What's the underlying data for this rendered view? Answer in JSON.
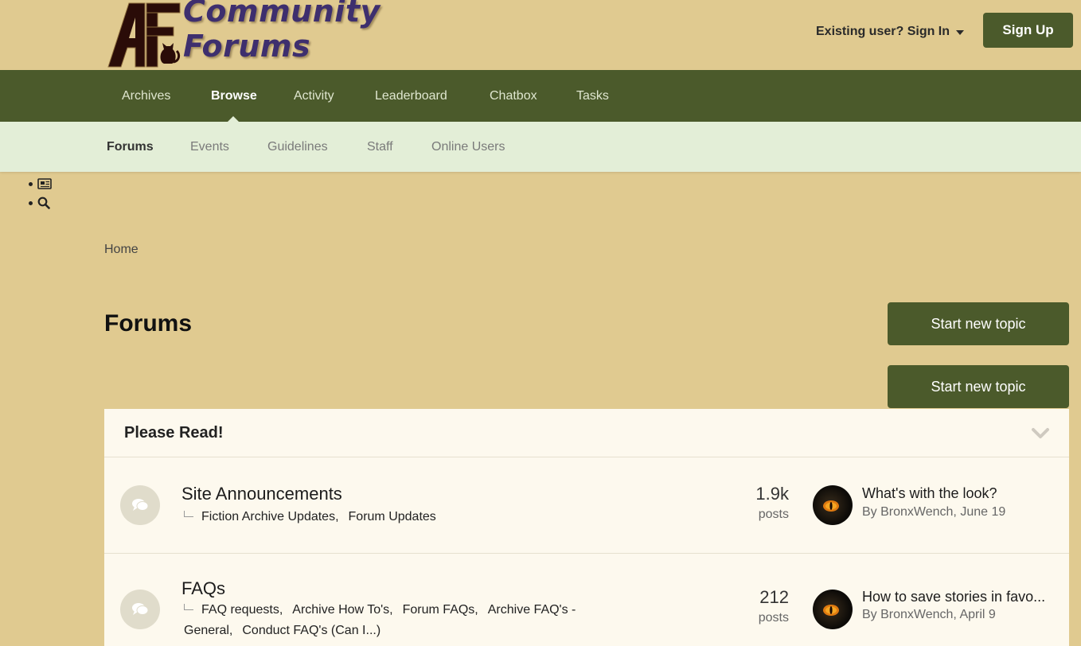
{
  "header": {
    "logo_letters": "AF",
    "logo_title": "Community Forums",
    "signin_label": "Existing user? Sign In",
    "signup_label": "Sign Up"
  },
  "primary_nav": [
    {
      "label": "Archives",
      "active": false
    },
    {
      "label": "Browse",
      "active": true
    },
    {
      "label": "Activity",
      "active": false
    },
    {
      "label": "Leaderboard",
      "active": false
    },
    {
      "label": "Chatbox",
      "active": false
    },
    {
      "label": "Tasks",
      "active": false
    }
  ],
  "secondary_nav": [
    {
      "label": "Forums",
      "active": true
    },
    {
      "label": "Events",
      "active": false
    },
    {
      "label": "Guidelines",
      "active": false
    },
    {
      "label": "Staff",
      "active": false
    },
    {
      "label": "Online Users",
      "active": false
    }
  ],
  "quick_links": [
    {
      "icon": "newspaper-icon"
    },
    {
      "icon": "search-icon"
    }
  ],
  "breadcrumb": {
    "home": "Home"
  },
  "page": {
    "title": "Forums",
    "start_topic_label": "Start new topic"
  },
  "category": {
    "title": "Please Read!",
    "forums": [
      {
        "title": "Site Announcements",
        "subforums": [
          "Fiction Archive Updates,",
          "Forum Updates"
        ],
        "posts": "1.9k",
        "posts_label": "posts",
        "last_post_title": "What's with the look?",
        "last_post_by": "By BronxWench,",
        "last_post_date": "June 19"
      },
      {
        "title": "FAQs",
        "subforums": [
          "FAQ requests,",
          "Archive How To's,",
          "Forum FAQs,",
          "Archive FAQ's - General,",
          "Conduct FAQ's (Can I...)"
        ],
        "posts": "212",
        "posts_label": "posts",
        "last_post_title": "How to save stories in favo...",
        "last_post_by": "By BronxWench,",
        "last_post_date": "April 9"
      }
    ]
  },
  "colors": {
    "page_bg": "#e0ca90",
    "nav_green": "#4b5a2b",
    "subnav_bg": "#e3eed7",
    "panel_bg": "#fdf9ee",
    "logo_purple": "#3e2f6e"
  }
}
